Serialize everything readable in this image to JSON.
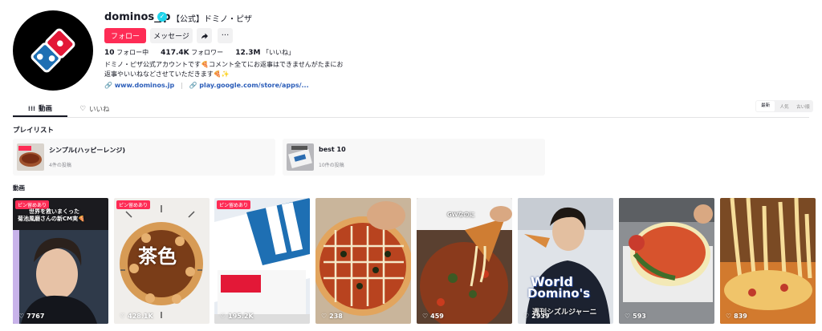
{
  "profile": {
    "username": "dominos_jp",
    "nickname": "【公式】ドミノ・ピザ",
    "follow_label": "フォロー",
    "message_label": "メッセージ",
    "more_label": "···",
    "following_count": "10",
    "following_label": "フォロー中",
    "followers_count": "417.4K",
    "followers_label": "フォロワー",
    "likes_count": "12.3M",
    "likes_label": "「いいね」",
    "bio_line1": "ドミノ・ピザ公式アカウントです🍕コメント全てにお返事はできませんがたまにお",
    "bio_line2": "返事やいいねなどさせていただきます🍕✨",
    "link1": "www.dominos.jp",
    "link2": "play.google.com/store/apps/..."
  },
  "tabs": [
    {
      "label": "動画"
    },
    {
      "label": "いいね"
    }
  ],
  "sort": {
    "options": [
      "最新",
      "人気",
      "古い順"
    ]
  },
  "playlists": {
    "title": "プレイリスト",
    "items": [
      {
        "title": "シンプル(ハッピーレンジ)",
        "count": "4件の投稿"
      },
      {
        "title": "best 10",
        "count": "10件の投稿"
      }
    ]
  },
  "videos": {
    "title": "動画",
    "pin_label": "ピン留めあり",
    "items": [
      {
        "views": "7767",
        "pinned": true,
        "caption": "世界を救いまくった",
        "caption2": "菊池風磨さんの新CM実🍕"
      },
      {
        "views": "428.1K",
        "pinned": true,
        "caption": "茶色"
      },
      {
        "views": "195.2K",
        "pinned": true
      },
      {
        "views": "238"
      },
      {
        "views": "459",
        "caption": "GWなのに"
      },
      {
        "views": "2939",
        "caption": "World",
        "caption2": "Domino's",
        "caption3": "週刊シズルジャーニ"
      },
      {
        "views": "593"
      },
      {
        "views": "839"
      }
    ]
  },
  "colors": {
    "accent": "#fe2c55",
    "domino_blue": "#2b6cb0",
    "domino_red": "#e31837"
  }
}
